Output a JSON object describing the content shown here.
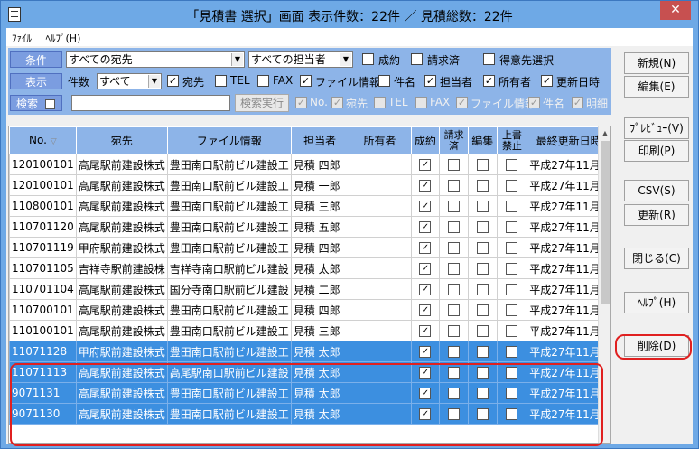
{
  "window": {
    "title": "「見積書  選択」画面   表示件数：22件   ／   見積総数：22件",
    "close_glyph": "✕"
  },
  "menu": {
    "file": "ﾌｧｲﾙ",
    "help": "ﾍﾙﾌﾟ(H)"
  },
  "filters": {
    "row1": {
      "label": "条件",
      "recipient_select": "すべての宛先",
      "staff_select": "すべての担当者",
      "contract_label": "成約",
      "invoiced_label": "請求済",
      "client_select_label": "得意先選択"
    },
    "row2": {
      "label": "表示",
      "count_label": "件数",
      "count_select": "すべて",
      "columns": [
        {
          "label": "宛先",
          "checked": true
        },
        {
          "label": "TEL",
          "checked": false
        },
        {
          "label": "FAX",
          "checked": false
        },
        {
          "label": "ファイル情報",
          "checked": true
        },
        {
          "label": "件名",
          "checked": false
        },
        {
          "label": "担当者",
          "checked": true
        },
        {
          "label": "所有者",
          "checked": true
        },
        {
          "label": "更新日時",
          "checked": true
        }
      ]
    },
    "row3": {
      "label": "検索",
      "search_value": "",
      "search_button": "検索実行",
      "columns": [
        {
          "label": "No.",
          "checked": true
        },
        {
          "label": "宛先",
          "checked": true
        },
        {
          "label": "TEL",
          "checked": false
        },
        {
          "label": "FAX",
          "checked": false
        },
        {
          "label": "ファイル情報",
          "checked": true
        },
        {
          "label": "件名",
          "checked": false
        },
        {
          "label": "明細",
          "checked": true
        }
      ]
    }
  },
  "table": {
    "headers": [
      "No.",
      "宛先",
      "ファイル情報",
      "担当者",
      "所有者",
      "成約",
      "請求済",
      "編集",
      "上書禁止",
      "最終更新日時"
    ],
    "rows": [
      {
        "no": "120100101",
        "dest": "高尾駅前建設株式",
        "file": "豊田南口駅前ビル建設工",
        "staff": "見積  四郎",
        "owner": "",
        "contract": true,
        "invoiced": false,
        "edit": false,
        "lock": false,
        "updated": "平成27年11月",
        "sel": false
      },
      {
        "no": "120100101",
        "dest": "高尾駅前建設株式",
        "file": "豊田南口駅前ビル建設工",
        "staff": "見積  一郎",
        "owner": "",
        "contract": true,
        "invoiced": false,
        "edit": false,
        "lock": false,
        "updated": "平成27年11月",
        "sel": false
      },
      {
        "no": "110800101",
        "dest": "高尾駅前建設株式",
        "file": "豊田南口駅前ビル建設工",
        "staff": "見積  三郎",
        "owner": "",
        "contract": true,
        "invoiced": false,
        "edit": false,
        "lock": false,
        "updated": "平成27年11月",
        "sel": false
      },
      {
        "no": "110701120",
        "dest": "高尾駅前建設株式",
        "file": "豊田南口駅前ビル建設工",
        "staff": "見積  五郎",
        "owner": "",
        "contract": true,
        "invoiced": false,
        "edit": false,
        "lock": false,
        "updated": "平成27年11月",
        "sel": false
      },
      {
        "no": "110701119",
        "dest": "甲府駅前建設株式",
        "file": "豊田南口駅前ビル建設工",
        "staff": "見積  四郎",
        "owner": "",
        "contract": true,
        "invoiced": false,
        "edit": false,
        "lock": false,
        "updated": "平成27年11月",
        "sel": false
      },
      {
        "no": "110701105",
        "dest": "吉祥寺駅前建設株",
        "file": "吉祥寺南口駅前ビル建設",
        "staff": "見積  太郎",
        "owner": "",
        "contract": true,
        "invoiced": false,
        "edit": false,
        "lock": false,
        "updated": "平成27年11月",
        "sel": false
      },
      {
        "no": "110701104",
        "dest": "高尾駅前建設株式",
        "file": "国分寺南口駅前ビル建設",
        "staff": "見積  二郎",
        "owner": "",
        "contract": true,
        "invoiced": false,
        "edit": false,
        "lock": false,
        "updated": "平成27年11月",
        "sel": false
      },
      {
        "no": "110700101",
        "dest": "高尾駅前建設株式",
        "file": "豊田南口駅前ビル建設工",
        "staff": "見積  四郎",
        "owner": "",
        "contract": true,
        "invoiced": false,
        "edit": false,
        "lock": false,
        "updated": "平成27年11月",
        "sel": false
      },
      {
        "no": "110100101",
        "dest": "高尾駅前建設株式",
        "file": "豊田南口駅前ビル建設工",
        "staff": "見積  三郎",
        "owner": "",
        "contract": true,
        "invoiced": false,
        "edit": false,
        "lock": false,
        "updated": "平成27年11月",
        "sel": false
      },
      {
        "no": "11071128",
        "dest": "甲府駅前建設株式",
        "file": "豊田南口駅前ビル建設工",
        "staff": "見積  太郎",
        "owner": "",
        "contract": true,
        "invoiced": false,
        "edit": false,
        "lock": false,
        "updated": "平成27年11月",
        "sel": true
      },
      {
        "no": "11071113",
        "dest": "高尾駅前建設株式",
        "file": "高尾駅南口駅前ビル建設",
        "staff": "見積  太郎",
        "owner": "",
        "contract": true,
        "invoiced": false,
        "edit": false,
        "lock": false,
        "updated": "平成27年11月",
        "sel": true
      },
      {
        "no": "9071131",
        "dest": "高尾駅前建設株式",
        "file": "豊田南口駅前ビル建設工",
        "staff": "見積  太郎",
        "owner": "",
        "contract": true,
        "invoiced": false,
        "edit": false,
        "lock": false,
        "updated": "平成27年11月",
        "sel": true
      },
      {
        "no": "9071130",
        "dest": "高尾駅前建設株式",
        "file": "豊田南口駅前ビル建設工",
        "staff": "見積  太郎",
        "owner": "",
        "contract": true,
        "invoiced": false,
        "edit": false,
        "lock": false,
        "updated": "平成27年11月",
        "sel": true
      }
    ]
  },
  "side_buttons": {
    "new": "新規(N)",
    "edit": "編集(E)",
    "preview": "ﾌﾟﾚﾋﾞｭｰ(V)",
    "print": "印刷(P)",
    "csv": "CSV(S)",
    "refresh": "更新(R)",
    "close": "閉じる(C)",
    "help": "ﾍﾙﾌﾟ(H)",
    "delete": "削除(D)"
  },
  "colors": {
    "titlebar": "#6ea9e6",
    "filter_bg": "#8db4e8",
    "selected_row": "#3c8fe0",
    "highlight_red": "#e02020"
  }
}
